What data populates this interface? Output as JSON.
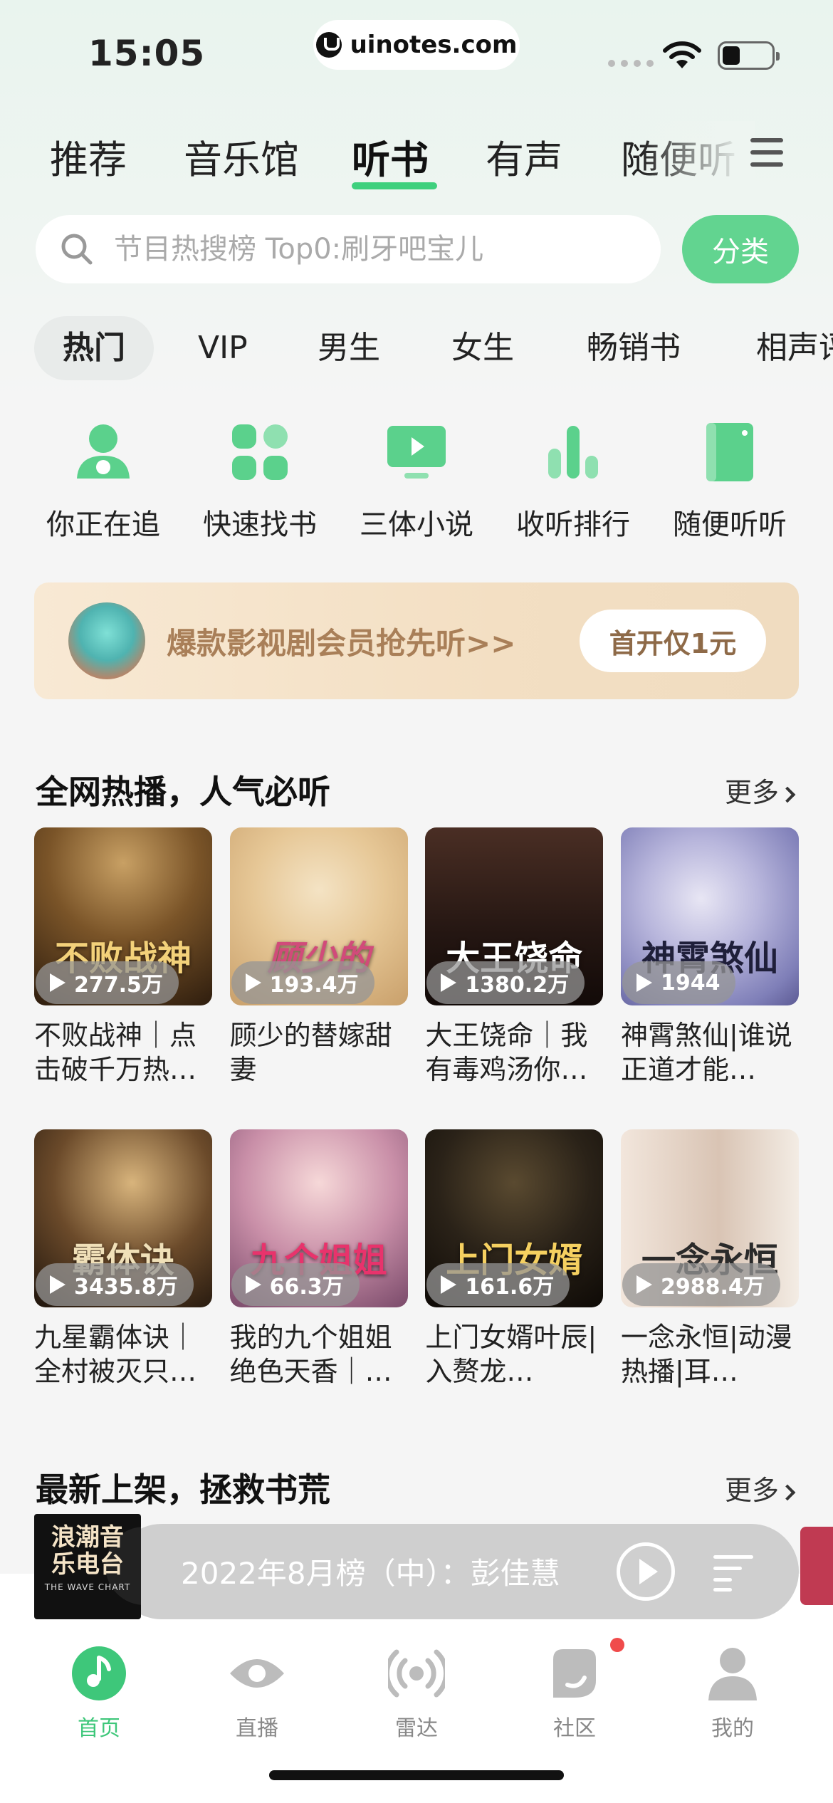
{
  "status_bar": {
    "time": "15:05",
    "url": "uinotes.com"
  },
  "top_tabs": [
    {
      "label": "推荐",
      "active": false
    },
    {
      "label": "音乐馆",
      "active": false
    },
    {
      "label": "听书",
      "active": true
    },
    {
      "label": "有声",
      "active": false
    },
    {
      "label": "随便听",
      "active": false
    }
  ],
  "search": {
    "placeholder": "节目热搜榜 Top0:刷牙吧宝儿",
    "category_button": "分类"
  },
  "filter_chips": [
    "热门",
    "VIP",
    "男生",
    "女生",
    "畅销书",
    "相声评"
  ],
  "quick_entries": [
    {
      "label": "你正在追",
      "icon": "person-icon"
    },
    {
      "label": "快速找书",
      "icon": "grid-icon"
    },
    {
      "label": "三体小说",
      "icon": "tv-icon"
    },
    {
      "label": "收听排行",
      "icon": "bar-chart-icon"
    },
    {
      "label": "随便听听",
      "icon": "book-icon"
    }
  ],
  "promo": {
    "text": "爆款影视剧会员抢先听>>",
    "button": "首开仅1元"
  },
  "section_hot": {
    "title": "全网热播，人气必听",
    "more": "更多",
    "books": [
      {
        "cover_text": "不败战神",
        "plays": "277.5万",
        "title": "不败战神｜点击破千万热…"
      },
      {
        "cover_text": "顾少的",
        "plays": "193.4万",
        "title": "顾少的替嫁甜妻"
      },
      {
        "cover_text": "大王饶命",
        "plays": "1380.2万",
        "title": "大王饶命｜我有毒鸡汤你…"
      },
      {
        "cover_text": "神霄煞仙",
        "plays": "1944",
        "title": "神霄煞仙|谁说正道才能…"
      },
      {
        "cover_text": "霸体诀",
        "plays": "3435.8万",
        "title": "九星霸体诀｜全村被灭只…"
      },
      {
        "cover_text": "九个姐姐",
        "plays": "66.3万",
        "title": "我的九个姐姐绝色天香｜…"
      },
      {
        "cover_text": "上门女婿",
        "plays": "161.6万",
        "title": "上门女婿叶辰|入赘龙…"
      },
      {
        "cover_text": "一念永恒",
        "plays": "2988.4万",
        "title": "一念永恒|动漫热播|耳…"
      }
    ]
  },
  "section_new": {
    "title": "最新上架，拯救书荒",
    "more": "更多"
  },
  "player": {
    "album_text": "浪潮音乐电台",
    "album_sub": "THE WAVE CHART",
    "track": "2022年8月榜（中）：彭佳慧"
  },
  "bottom_nav": [
    {
      "label": "首页",
      "icon": "home-music-icon",
      "active": true
    },
    {
      "label": "直播",
      "icon": "eye-icon",
      "active": false
    },
    {
      "label": "雷达",
      "icon": "radar-icon",
      "active": false
    },
    {
      "label": "社区",
      "icon": "community-icon",
      "active": false,
      "badge": true
    },
    {
      "label": "我的",
      "icon": "profile-icon",
      "active": false
    }
  ],
  "colors": {
    "accent": "#3ed07d",
    "promo_text": "#a97f58"
  }
}
